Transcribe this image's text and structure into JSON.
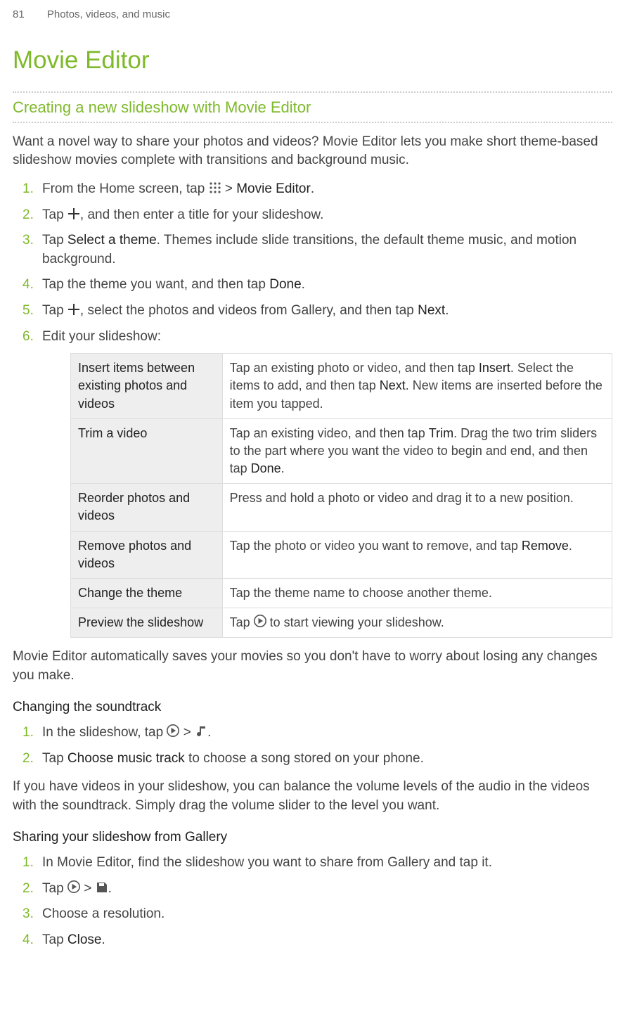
{
  "header": {
    "page_number": "81",
    "section": "Photos, videos, and music"
  },
  "h1": "Movie Editor",
  "h2": "Creating a new slideshow with Movie Editor",
  "intro": "Want a novel way to share your photos and videos? Movie Editor lets you make short theme-based slideshow movies complete with transitions and background music.",
  "steps": {
    "s1a": "From the Home screen, tap ",
    "s1b": " > ",
    "s1c": "Movie Editor",
    "s1d": ".",
    "s2a": "Tap ",
    "s2b": ", and then enter a title for your slideshow.",
    "s3a": "Tap ",
    "s3b": "Select a theme",
    "s3c": ". Themes include slide transitions, the default theme music, and motion background.",
    "s4a": "Tap the theme you want, and then tap ",
    "s4b": "Done",
    "s4c": ".",
    "s5a": "Tap ",
    "s5b": ", select the photos and videos from Gallery, and then tap ",
    "s5c": "Next",
    "s5d": ".",
    "s6": "Edit your slideshow:"
  },
  "table": {
    "r1": {
      "left": "Insert items between existing photos and videos",
      "a": "Tap an existing photo or video, and then tap ",
      "b": "Insert",
      "c": ". Select the items to add, and then tap ",
      "d": "Next",
      "e": ". New items are inserted before the item you tapped."
    },
    "r2": {
      "left": "Trim a video",
      "a": "Tap an existing video, and then tap ",
      "b": "Trim",
      "c": ". Drag the two trim sliders to the part where you want the video to begin and end, and then tap ",
      "d": "Done",
      "e": "."
    },
    "r3": {
      "left": "Reorder photos and videos",
      "a": "Press and hold a photo or video and drag it to a new position."
    },
    "r4": {
      "left": "Remove photos and videos",
      "a": "Tap the photo or video you want to remove, and tap ",
      "b": "Remove",
      "c": "."
    },
    "r5": {
      "left": "Change the theme",
      "a": "Tap the theme name to choose another theme."
    },
    "r6": {
      "left": "Preview the slideshow",
      "a": "Tap ",
      "b": " to start viewing your slideshow."
    }
  },
  "after_table": "Movie Editor automatically saves your movies so you don't have to worry about losing any changes you make.",
  "sub1": {
    "title": "Changing the soundtrack",
    "s1a": "In the slideshow, tap ",
    "s1b": " > ",
    "s1c": ".",
    "s2a": "Tap ",
    "s2b": "Choose music track",
    "s2c": " to choose a song stored on your phone.",
    "after": "If you have videos in your slideshow, you can balance the volume levels of the audio in the videos with the soundtrack. Simply drag the volume slider to the level you want."
  },
  "sub2": {
    "title": "Sharing your slideshow from Gallery",
    "s1": "In Movie Editor, find the slideshow you want to share from Gallery and tap it.",
    "s2a": "Tap ",
    "s2b": " > ",
    "s2c": ".",
    "s3": "Choose a resolution.",
    "s4a": "Tap ",
    "s4b": "Close",
    "s4c": "."
  }
}
